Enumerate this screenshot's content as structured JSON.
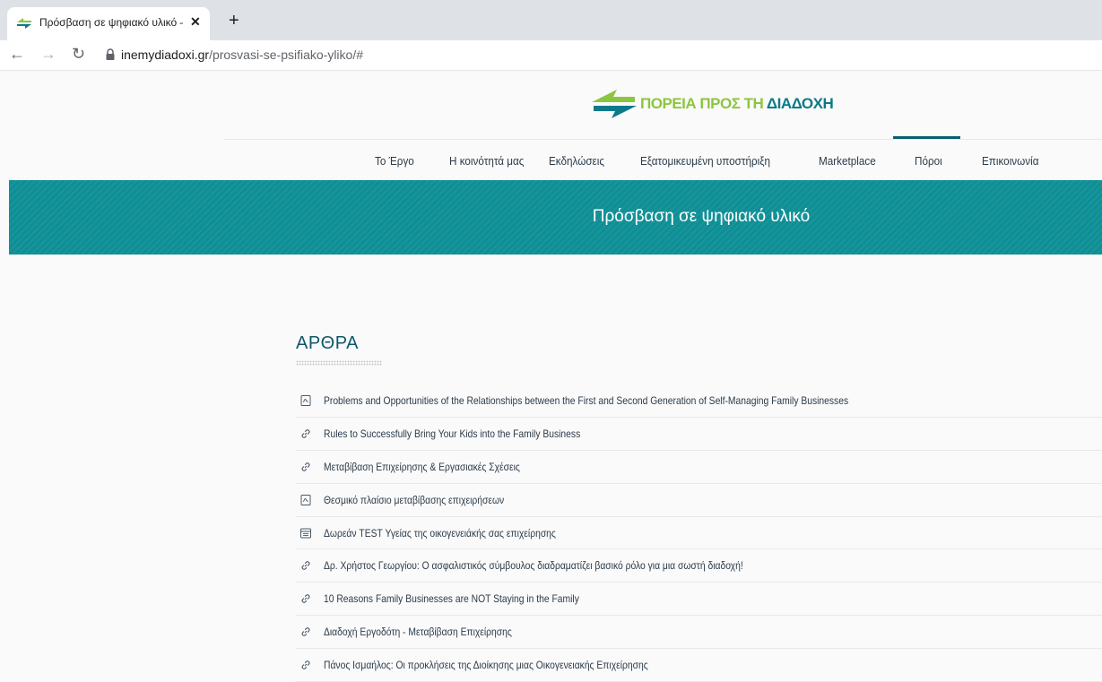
{
  "browser": {
    "tab_title": "Πρόσβαση σε ψηφιακό υλικό – Π",
    "url_domain": "inemydiadoxi.gr",
    "url_path": "/prosvasi-se-psifiako-yliko/#"
  },
  "logo": {
    "part1": "ΠΟΡΕΙΑ ΠΡΟΣ ΤΗ ",
    "part2": "ΔΙΑΔΟΧΗ"
  },
  "nav": [
    {
      "label": "Το Έργο"
    },
    {
      "label": "Η κοινότητά μας"
    },
    {
      "label": "Εκδηλώσεις"
    },
    {
      "label": "Εξατομικευμένη υποστήριξη"
    },
    {
      "label": "Marketplace"
    },
    {
      "label": "Πόροι"
    },
    {
      "label": "Επικοινωνία"
    }
  ],
  "nav_active": "Πόροι",
  "banner": {
    "title": "Πρόσβαση σε ψηφιακό υλικό"
  },
  "articles": {
    "heading": "ΑΡΘΡΑ",
    "items": [
      {
        "icon": "pdf-icon",
        "label": "Problems and Opportunities of the Relationships between the First and Second Generation of Self-Managing Family Businesses"
      },
      {
        "icon": "link-icon",
        "label": "Rules to Successfully Bring Your Kids into the Family Business"
      },
      {
        "icon": "link-icon",
        "label": "Μεταβίβαση Επιχείρησης & Εργασιακές Σχέσεις"
      },
      {
        "icon": "pdf-icon",
        "label": "Θεσμικό πλαίσιο μεταβίβασης επιχειρήσεων"
      },
      {
        "icon": "form-icon",
        "label": "Δωρεάν TEST Υγείας της οικογενειάκής σας επιχείρησης"
      },
      {
        "icon": "link-icon",
        "label": "Δρ. Χρήστος Γεωργίου: Ο ασφαλιστικός σύμβουλος διαδραματίζει βασικό ρόλο για μια σωστή διαδοχή!"
      },
      {
        "icon": "link-icon",
        "label": "10 Reasons Family Businesses are NOT Staying in the Family"
      },
      {
        "icon": "link-icon",
        "label": "Διαδοχή Εργοδότη - Μεταβίβαση Επιχείρησης"
      },
      {
        "icon": "link-icon",
        "label": "Πάνος Ισμαήλος: Οι προκλήσεις της Διοίκησης μιας Οικογενειακής Επιχείρησης"
      }
    ]
  },
  "colors": {
    "banner": "#0e8f95",
    "heading": "#10576a",
    "logo_green": "#8cc63f",
    "logo_teal": "#0a7a8a"
  }
}
